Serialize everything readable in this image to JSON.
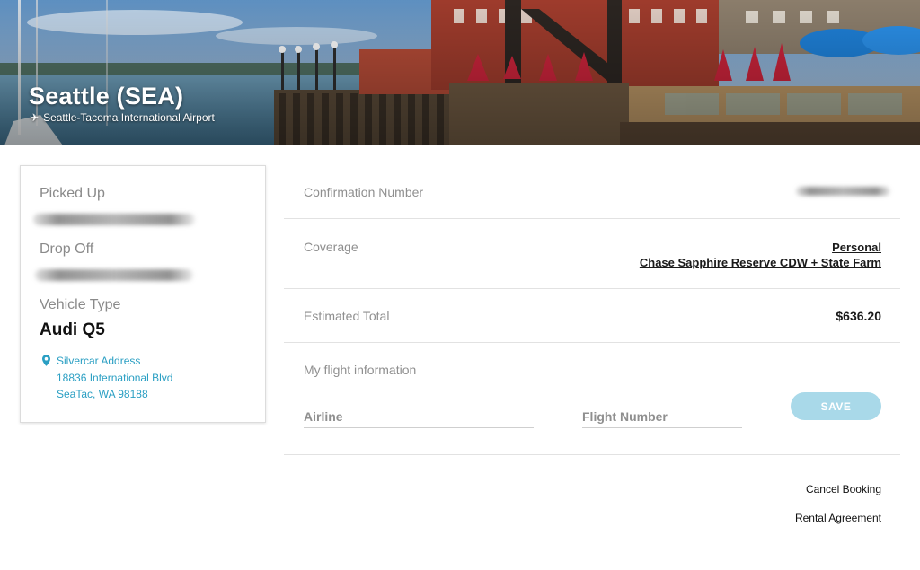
{
  "hero": {
    "title": "Seattle (SEA)",
    "subtitle": "Seattle-Tacoma International Airport",
    "subtitle_icon": "airplane-icon"
  },
  "summary": {
    "picked_up_label": "Picked Up",
    "drop_off_label": "Drop Off",
    "vehicle_type_label": "Vehicle Type",
    "vehicle": "Audi Q5",
    "address_icon": "map-pin-icon",
    "address_title": "Silvercar Address",
    "address_line1": "18836 International Blvd",
    "address_line2": "SeaTac, WA 98188"
  },
  "details": {
    "confirmation_label": "Confirmation Number",
    "coverage_label": "Coverage",
    "coverage_type": "Personal",
    "coverage_detail": "Chase Sapphire Reserve CDW + State Farm",
    "total_label": "Estimated Total",
    "total_value": "$636.20"
  },
  "flight": {
    "section_label": "My flight information",
    "airline_placeholder": "Airline",
    "flight_number_placeholder": "Flight Number",
    "save_label": "SAVE"
  },
  "actions": {
    "cancel_label": "Cancel Booking",
    "agreement_label": "Rental Agreement"
  },
  "colors": {
    "accent": "#2a9fc3",
    "save_button": "#a9d9e9"
  }
}
